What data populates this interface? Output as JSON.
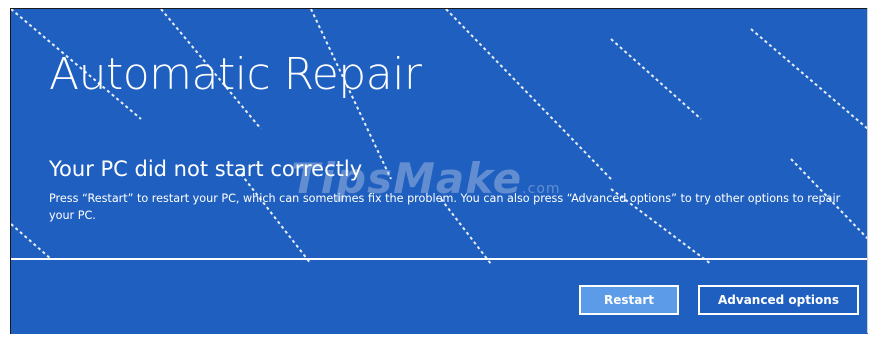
{
  "screen": {
    "title": "Automatic Repair",
    "subtitle": "Your PC did not start correctly",
    "description": "Press “Restart” to restart your PC, which can sometimes fix the problem. You can also press “Advanced options” to try other options to repair your PC.",
    "background_color": "#1f5fbf"
  },
  "watermark": {
    "text": "TipsMake",
    "suffix": ".com"
  },
  "buttons": {
    "restart_label": "Restart",
    "advanced_label": "Advanced options",
    "restart_color": "#5c9be8"
  }
}
